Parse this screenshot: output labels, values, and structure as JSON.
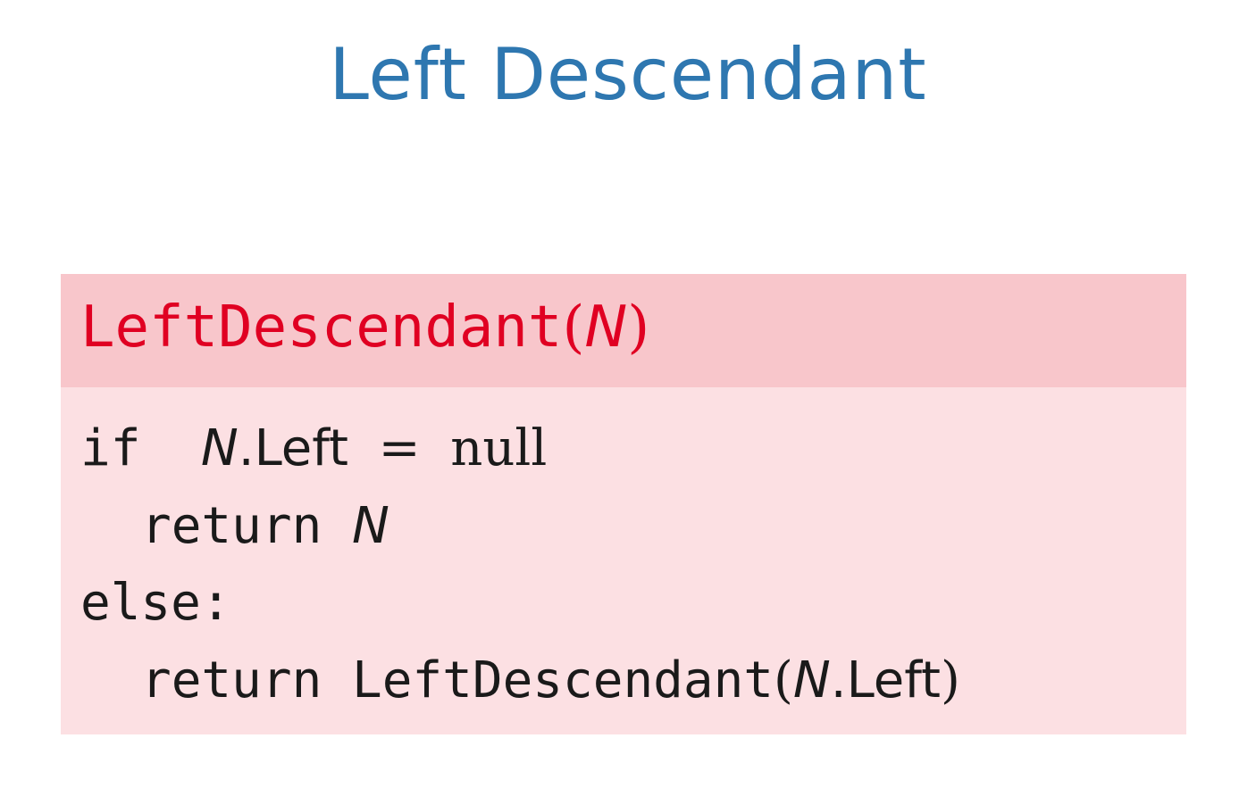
{
  "colors": {
    "title": "#2e77b0",
    "block_header_bg": "#f8c6cb",
    "block_body_bg": "#fce0e3",
    "block_title_text": "#e00022",
    "code_text": "#1a1a1a"
  },
  "slide": {
    "title": "Left Descendant"
  },
  "block": {
    "title_name": "LeftDescendant",
    "title_open": "(",
    "title_param": "N",
    "title_close": ")",
    "lines": [
      {
        "kw": "if",
        "var": "N",
        "field": ".Left",
        "op": "=",
        "val": "null"
      },
      {
        "kw": "return",
        "var": "N"
      },
      {
        "kw": "else:"
      },
      {
        "kw": "return",
        "fn": "LeftDescendant",
        "open": "(",
        "var": "N",
        "field": ".Left",
        "close": ")"
      }
    ]
  }
}
